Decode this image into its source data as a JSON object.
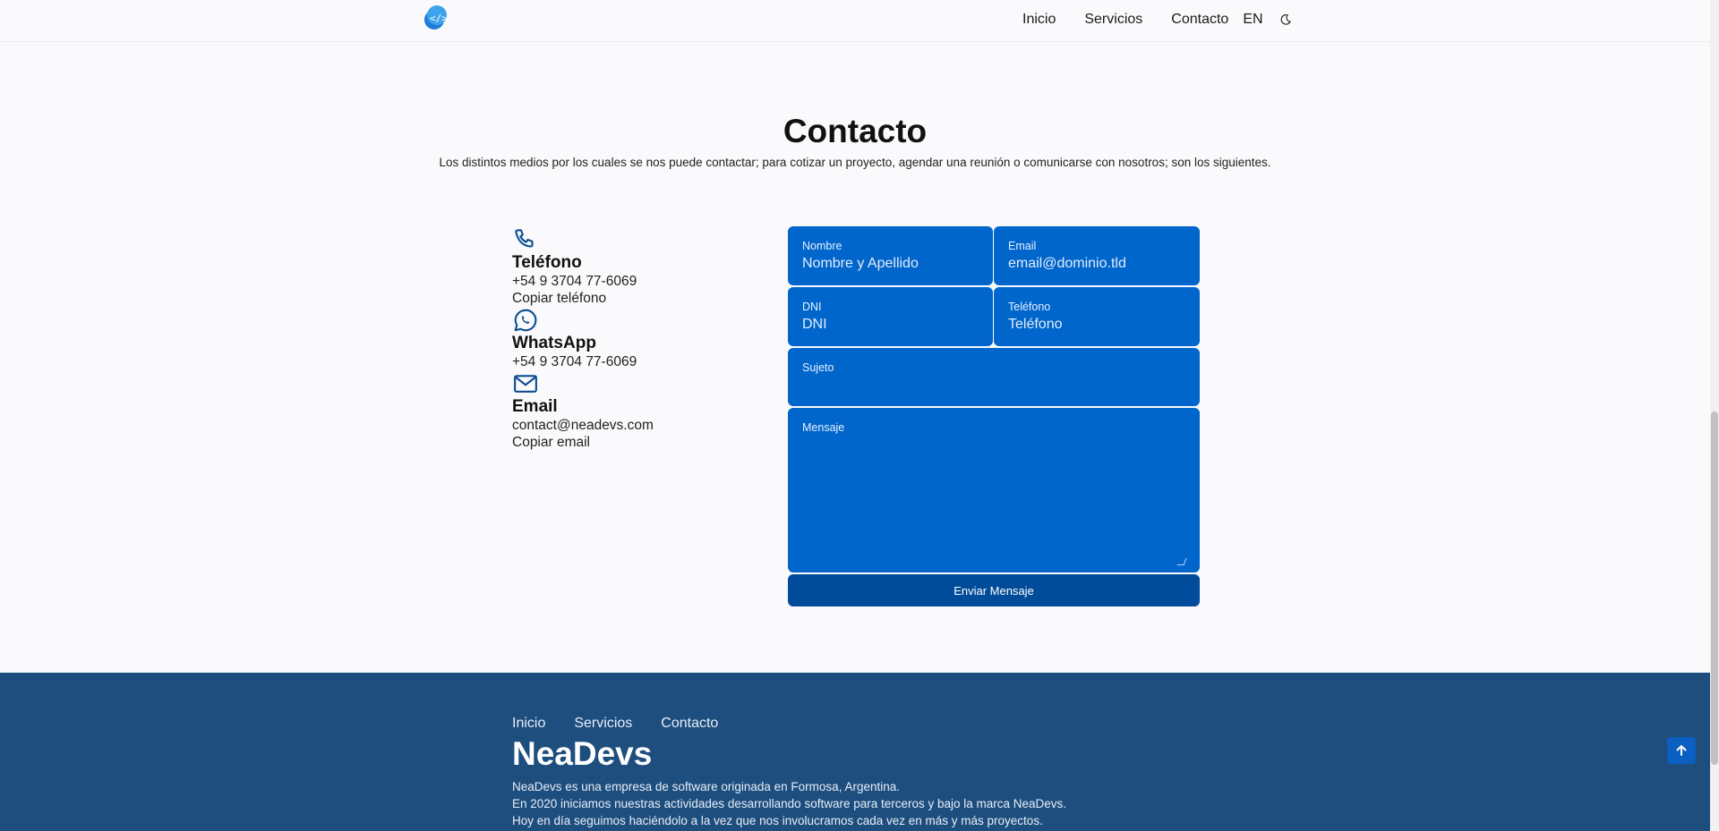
{
  "header": {
    "nav": {
      "inicio": "Inicio",
      "servicios": "Servicios",
      "contacto": "Contacto",
      "lang": "EN"
    }
  },
  "contact": {
    "title": "Contacto",
    "subtitle": "Los distintos medios por los cuales se nos puede contactar; para cotizar un proyecto, agendar una reunión o comunicarse con nosotros; son los siguientes.",
    "phone": {
      "heading": "Teléfono",
      "value": "+54 9 3704 77-6069",
      "copy": "Copiar teléfono"
    },
    "whatsapp": {
      "heading": "WhatsApp",
      "value": "+54 9 3704 77-6069"
    },
    "email": {
      "heading": "Email",
      "value": "contact@neadevs.com",
      "copy": "Copiar email"
    }
  },
  "form": {
    "nombre": {
      "label": "Nombre",
      "placeholder": "Nombre y Apellido"
    },
    "email": {
      "label": "Email",
      "placeholder": "email@dominio.tld"
    },
    "dni": {
      "label": "DNI",
      "placeholder": "DNI"
    },
    "telefono": {
      "label": "Teléfono",
      "placeholder": "Teléfono"
    },
    "sujeto": {
      "label": "Sujeto",
      "placeholder": ""
    },
    "mensaje": {
      "label": "Mensaje",
      "placeholder": ""
    },
    "submit": "Enviar Mensaje"
  },
  "footer": {
    "nav": {
      "inicio": "Inicio",
      "servicios": "Servicios",
      "contacto": "Contacto"
    },
    "brand": "NeaDevs",
    "desc": [
      "NeaDevs es una empresa de software originada en Formosa, Argentina.",
      "En 2020 iniciamos nuestras actividades desarrollando software para terceros y bajo la marca NeaDevs.",
      "Hoy en día seguimos haciéndolo a la vez que nos involucramos cada vez en más y más proyectos."
    ]
  },
  "colors": {
    "accent": "#0066cc",
    "button": "#004c9a",
    "footer": "#1e4e7e",
    "icon": "#0d4f8f"
  },
  "icons": [
    "logo",
    "moon-icon",
    "phone-icon",
    "whatsapp-icon",
    "mail-icon",
    "arrow-up-icon"
  ]
}
